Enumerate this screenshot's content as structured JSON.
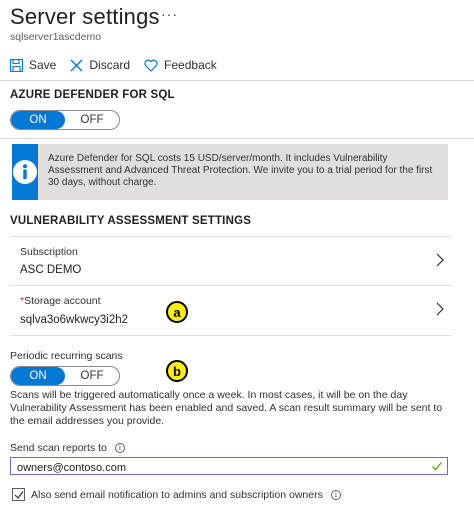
{
  "header": {
    "title": "Server settings",
    "more": "···",
    "subtitle": "sqlserver1ascdemo"
  },
  "toolbar": {
    "save_label": "Save",
    "discard_label": "Discard",
    "feedback_label": "Feedback"
  },
  "defender": {
    "heading": "AZURE DEFENDER FOR SQL",
    "toggle_on": "ON",
    "toggle_off": "OFF",
    "selected": "ON",
    "info_text": "Azure Defender for SQL costs 15 USD/server/month. It includes Vulnerability Assessment and Advanced Threat Protection. We invite you to a trial period for the first 30 days, without charge."
  },
  "va": {
    "heading": "VULNERABILITY ASSESSMENT SETTINGS",
    "subscription_label": "Subscription",
    "subscription_value": "ASC DEMO",
    "storage_required_mark": "*",
    "storage_label": "Storage account",
    "storage_value": "sqlva3o6wkwcy3i2h2",
    "badge_a": "a",
    "badge_b": "b",
    "scans_label": "Periodic recurring scans",
    "scans_on": "ON",
    "scans_off": "OFF",
    "scans_selected": "ON",
    "scans_description": "Scans will be triggered automatically once a week. In most cases, it will be on the day Vulnerability Assessment has been enabled and saved. A scan result summary will be sent to the email addresses you provide.",
    "send_reports_label": "Send scan reports to",
    "email_value": "owners@contoso.com",
    "also_notify_label": "Also send email notification to admins and subscription owners",
    "also_notify_checked": true
  },
  "colors": {
    "accent": "#0078d4",
    "badge": "#fef002",
    "input_border": "#8661c5"
  }
}
